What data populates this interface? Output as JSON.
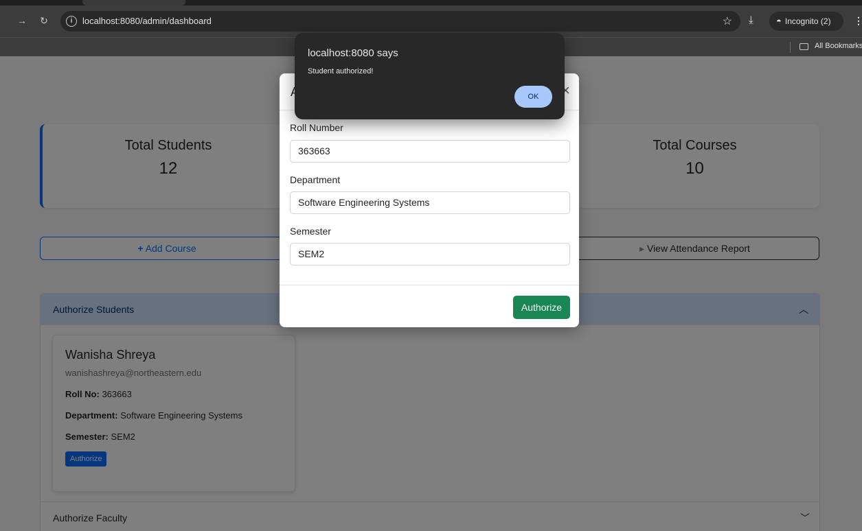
{
  "browser": {
    "url": "localhost:8080/admin/dashboard",
    "profile_label": "Incognito (2)",
    "bookmarks_label": "All Bookmarks"
  },
  "stats": {
    "students_label": "Total Students",
    "students_value": "12",
    "courses_label": "Total Courses",
    "courses_value": "10"
  },
  "actions": {
    "add_icon": "+",
    "add_label": "Add Course",
    "report_icon": "▸",
    "report_label": "View Attendance Report"
  },
  "accordion": {
    "students_header": "Authorize Students",
    "faculty_header": "Authorize Faculty",
    "student": {
      "name": "Wanisha Shreya",
      "email": "wanishashreya@northeastern.edu",
      "roll_label": "Roll No:",
      "roll": "363663",
      "dept_label": "Department:",
      "dept": "Software Engineering Systems",
      "sem_label": "Semester:",
      "sem": "SEM2",
      "button": "Authorize"
    }
  },
  "modal": {
    "title": "A",
    "close": "×",
    "roll_label": "Roll Number",
    "roll_value": "363663",
    "dept_label": "Department",
    "dept_value": "Software Engineering Systems",
    "sem_label": "Semester",
    "sem_value": "SEM2",
    "submit": "Authorize"
  },
  "alert": {
    "title": "localhost:8080 says",
    "message": "Student authorized!",
    "ok": "OK"
  }
}
